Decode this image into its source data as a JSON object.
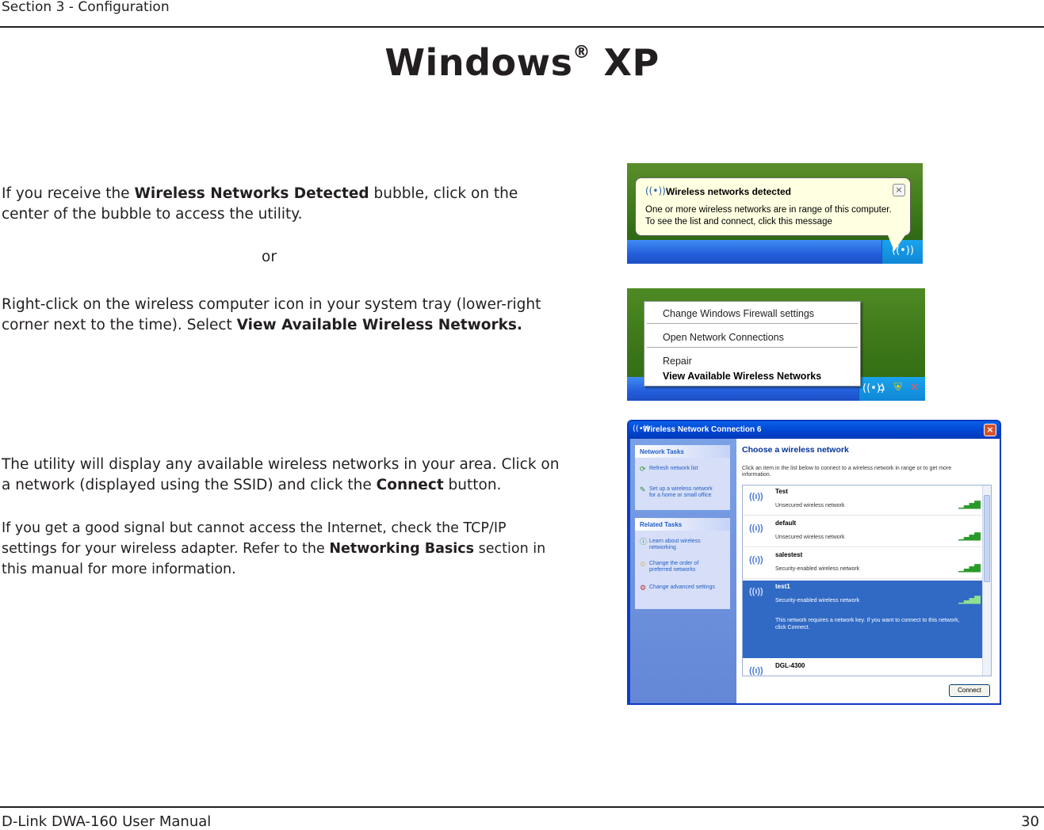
{
  "header": {
    "section": "Section 3 - Configuration"
  },
  "title": {
    "main": "Windows",
    "reg": "®",
    "suffix": "XP"
  },
  "paragraphs": {
    "p1_pre": "If you receive the ",
    "p1_bold": "Wireless Networks Detected",
    "p1_post": " bubble, click on the center of the bubble to access the utility.",
    "or": "or",
    "p2_pre": "Right-click on the wireless computer icon in your system tray (lower-right corner next to the time). Select ",
    "p2_bold": "View Available Wireless Networks.",
    "p3_pre": "The utility will display any available wireless networks in your area. Click on a network (displayed using the SSID) and click the ",
    "p3_bold": "Connect",
    "p3_post": " button.",
    "p4_pre": "If you get a good signal but cannot access the Internet, check the TCP/IP settings for your wireless adapter. Refer to the ",
    "p4_bold": "Networking Basics",
    "p4_post": " section in this manual for more information."
  },
  "balloon": {
    "icon": "wireless-icon",
    "title": "Wireless networks detected",
    "line1": "One or more wireless networks are in range of this computer.",
    "line2": "To see the list and connect, click this message",
    "close": "×"
  },
  "context_menu": {
    "items": [
      "Change Windows Firewall settings",
      "Open Network Connections",
      "Repair",
      "View Available Wireless Networks"
    ]
  },
  "dialog": {
    "title": "Wireless Network Connection 6",
    "close": "×",
    "network_tasks_header": "Network Tasks",
    "network_tasks": [
      "Refresh network list",
      "Set up a wireless network for a home or small office"
    ],
    "related_tasks_header": "Related Tasks",
    "related_tasks": [
      "Learn about wireless networking",
      "Change the order of preferred networks",
      "Change advanced settings"
    ],
    "heading": "Choose a wireless network",
    "description": "Click an item in the list below to connect to a wireless network in range or to get more information.",
    "networks": [
      {
        "name": "Test",
        "status": "Unsecured wireless network"
      },
      {
        "name": "default",
        "status": "Unsecured wireless network"
      },
      {
        "name": "salestest",
        "status": "Security-enabled wireless network"
      },
      {
        "name": "test1",
        "status": "Security-enabled wireless network",
        "message": "This network requires a network key. If you want to connect to this network, click Connect."
      },
      {
        "name": "DGL-4300",
        "status": ""
      }
    ],
    "connect_label": "Connect"
  },
  "footer": {
    "left": "D-Link DWA-160 User Manual",
    "page": "30"
  }
}
